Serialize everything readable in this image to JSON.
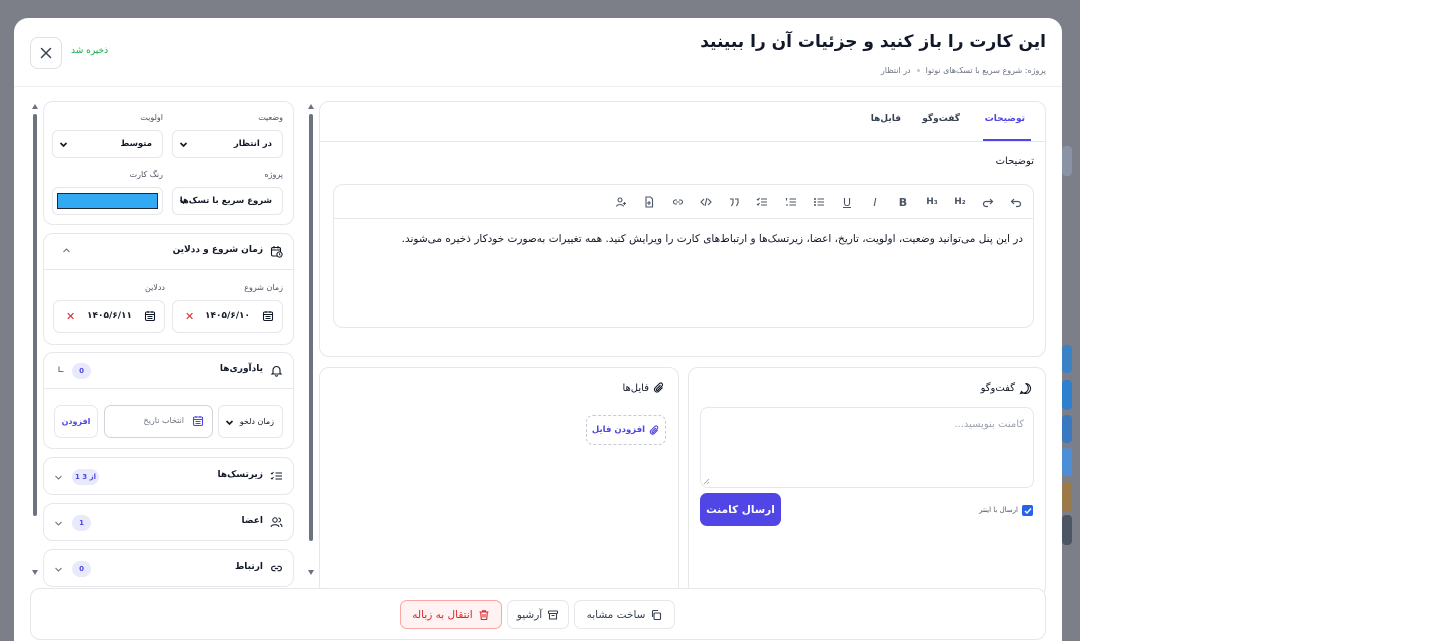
{
  "modal": {
    "title": "این کارت را باز کنید و جزئیات آن را ببینید",
    "breadcrumb": {
      "project": "پروژه: شروع سریع با تسک‌های نوتوا",
      "status": "در انتظار"
    },
    "saved_status": "ذخیره شد"
  },
  "tabs": [
    {
      "label": "توضیحات",
      "active": true
    },
    {
      "label": "گفت‌وگو",
      "active": false
    },
    {
      "label": "فایل‌ها",
      "active": false
    }
  ],
  "description": {
    "heading": "توضیحات",
    "toolbar_icons": [
      "undo-icon",
      "redo-icon",
      "heading2-icon",
      "heading3-icon",
      "bold-icon",
      "italic-icon",
      "underline-icon",
      "bullet-list-icon",
      "ordered-list-icon",
      "task-list-icon",
      "quote-icon",
      "code-icon",
      "link-icon",
      "file-icon",
      "mention-icon"
    ],
    "toolbar_labels": {
      "h2": "H₂",
      "h3": "H₃",
      "bold": "B",
      "italic": "I",
      "underline": "U"
    },
    "body": "در این پنل می‌توانید وضعیت، اولویت، تاریخ، اعضا، زیرتسک‌ها و ارتباط‌های کارت را ویرایش کنید. همه تغییرات به‌صورت خودکار ذخیره می‌شوند."
  },
  "comments": {
    "heading": "گفت‌وگو",
    "placeholder": "کامنت بنویسید...",
    "send_label": "ارسال کامنت",
    "enter_to_send_label": "ارسال با اینتر",
    "enter_to_send_checked": true
  },
  "files": {
    "heading": "فایل‌ها",
    "add_label": "افزودن فایل"
  },
  "sidebar": {
    "status_label": "وضعیت",
    "status_value": "در انتظار",
    "priority_label": "اولویت",
    "priority_value": "متوسط",
    "project_label": "پروژه",
    "project_value": "شروع سریع با تسک‌ها",
    "card_color_label": "رنگ کارت",
    "card_color": "#31a9f3",
    "schedule": {
      "title": "زمان شروع و ددلاین",
      "start_label": "زمان شروع",
      "start_value": "۱۴۰۵/۶/۱۰",
      "deadline_label": "ددلاین",
      "deadline_value": "۱۴۰۵/۶/۱۱"
    },
    "reminders": {
      "title": "یادآوری‌ها",
      "count": "0",
      "time_select": "زمان دلخو",
      "date_placeholder": "انتخاب تاریخ",
      "add_label": "افزودن"
    },
    "subtasks": {
      "title": "زیرتسک‌ها",
      "badge": "1 از 3"
    },
    "members": {
      "title": "اعضا",
      "count": "1"
    },
    "relations": {
      "title": "ارتباط",
      "count": "0"
    }
  },
  "footer": {
    "duplicate_label": "ساخت مشابه",
    "archive_label": "آرشیو",
    "trash_label": "انتقال به زباله"
  },
  "colors": {
    "accent": "#4f46e5",
    "danger": "#dc2626",
    "success": "#16a34a",
    "backdrop": "#7d7f88"
  }
}
